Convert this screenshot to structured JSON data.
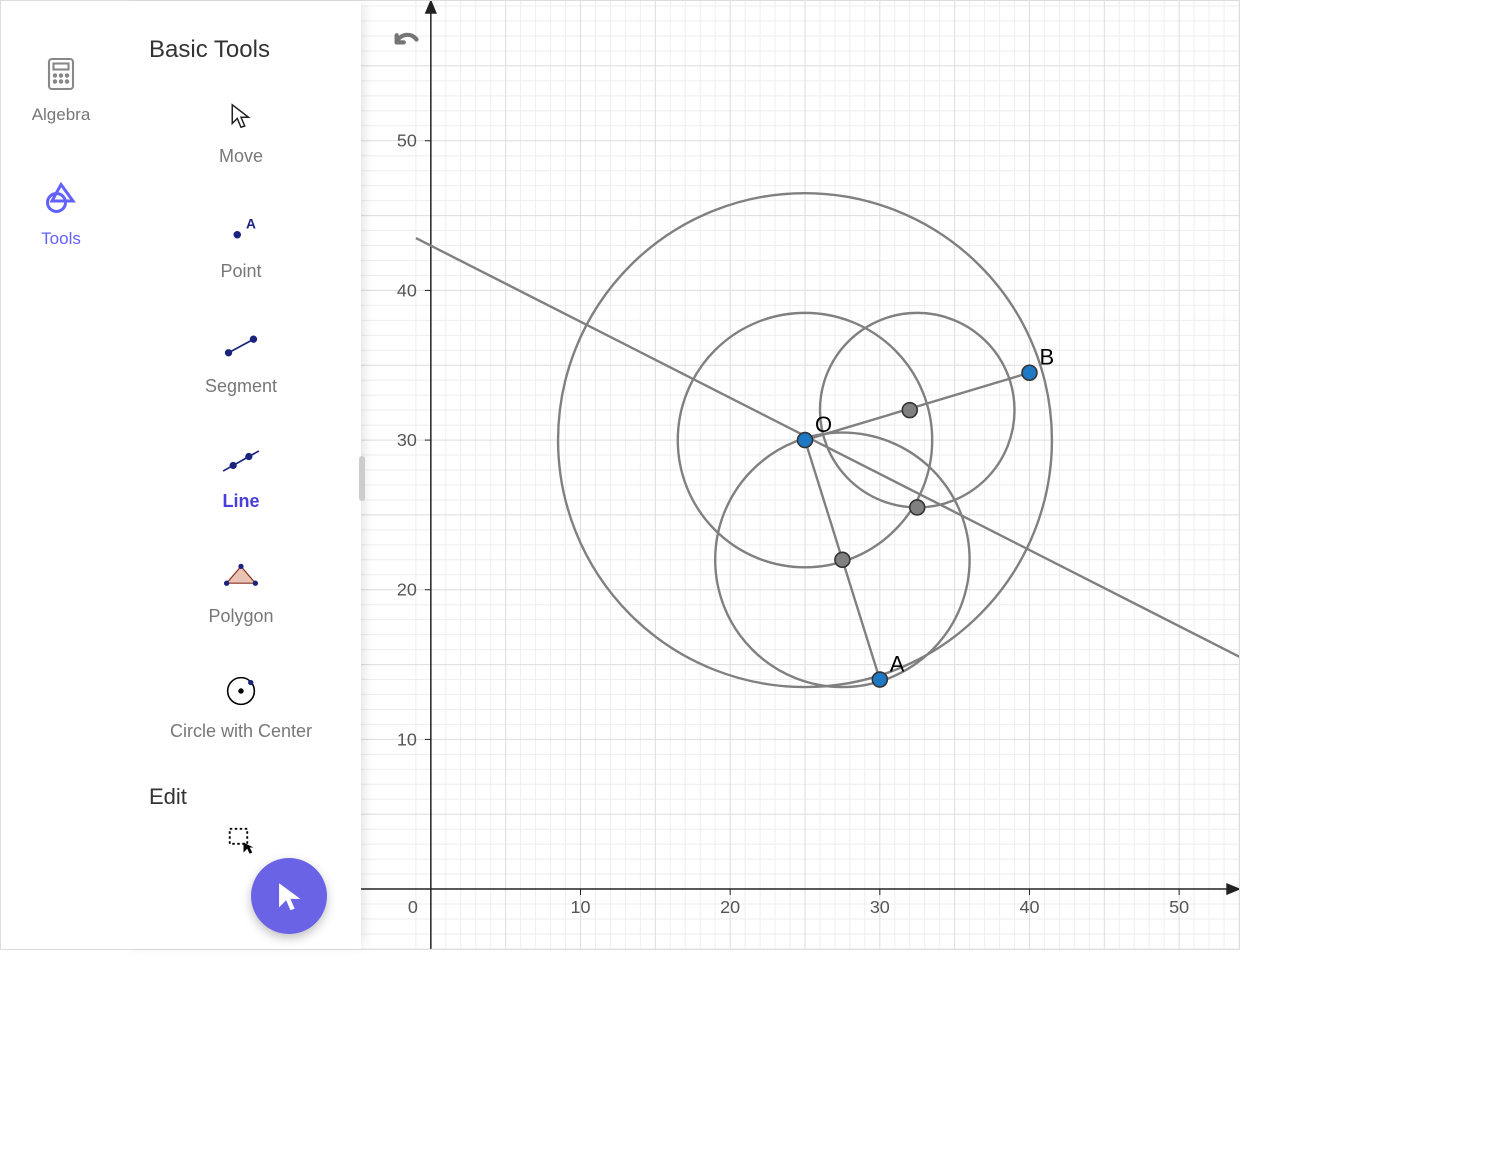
{
  "rail": {
    "algebra_label": "Algebra",
    "tools_label": "Tools",
    "active": "tools"
  },
  "tools_panel": {
    "basic_header": "Basic Tools",
    "edit_header": "Edit",
    "items": [
      {
        "id": "move",
        "label": "Move"
      },
      {
        "id": "point",
        "label": "Point"
      },
      {
        "id": "segment",
        "label": "Segment"
      },
      {
        "id": "line",
        "label": "Line",
        "selected": true
      },
      {
        "id": "polygon",
        "label": "Polygon"
      },
      {
        "id": "circle",
        "label": "Circle with Center"
      }
    ]
  },
  "axes": {
    "x_ticks": [
      "10",
      "20",
      "30",
      "40",
      "50"
    ],
    "y_ticks": [
      "10",
      "20",
      "30",
      "40",
      "50"
    ],
    "origin_label": "0"
  },
  "chart_data": {
    "type": "diagram",
    "title": "GeoGebra geometry canvas",
    "xlim": [
      -1,
      58
    ],
    "ylim": [
      -4,
      60
    ],
    "grid": true,
    "points": [
      {
        "label": "O",
        "x": 25,
        "y": 30,
        "color": "#1f78c4"
      },
      {
        "label": "A",
        "x": 30,
        "y": 14,
        "color": "#1f78c4"
      },
      {
        "label": "B",
        "x": 40,
        "y": 34.5,
        "color": "#1f78c4"
      },
      {
        "label": "",
        "x": 32,
        "y": 32,
        "color": "#808080"
      },
      {
        "label": "",
        "x": 32.5,
        "y": 25.5,
        "color": "#808080"
      },
      {
        "label": "",
        "x": 27.5,
        "y": 22,
        "color": "#808080"
      }
    ],
    "segments": [
      {
        "from": "O",
        "to": "A"
      },
      {
        "from": "O",
        "to": "B"
      }
    ],
    "lines": [
      {
        "p1": [
          -1,
          43.5
        ],
        "p2": [
          58,
          13.5
        ],
        "note": "extended diagonal line"
      }
    ],
    "circles": [
      {
        "cx": 25,
        "cy": 30,
        "r": 16.5
      },
      {
        "cx": 25,
        "cy": 30,
        "r": 8.5
      },
      {
        "cx": 32.5,
        "cy": 32,
        "r": 6.5
      },
      {
        "cx": 27.5,
        "cy": 22,
        "r": 8.5
      }
    ]
  },
  "colors": {
    "accent": "#6a63e6",
    "tool_selected": "#4a3fd6",
    "grid_minor": "#eeeeee",
    "grid_major": "#c9c9c9",
    "axis": "#333333",
    "geo_stroke": "#808080",
    "point_blue": "#1f78c4",
    "point_grey": "#808080"
  }
}
